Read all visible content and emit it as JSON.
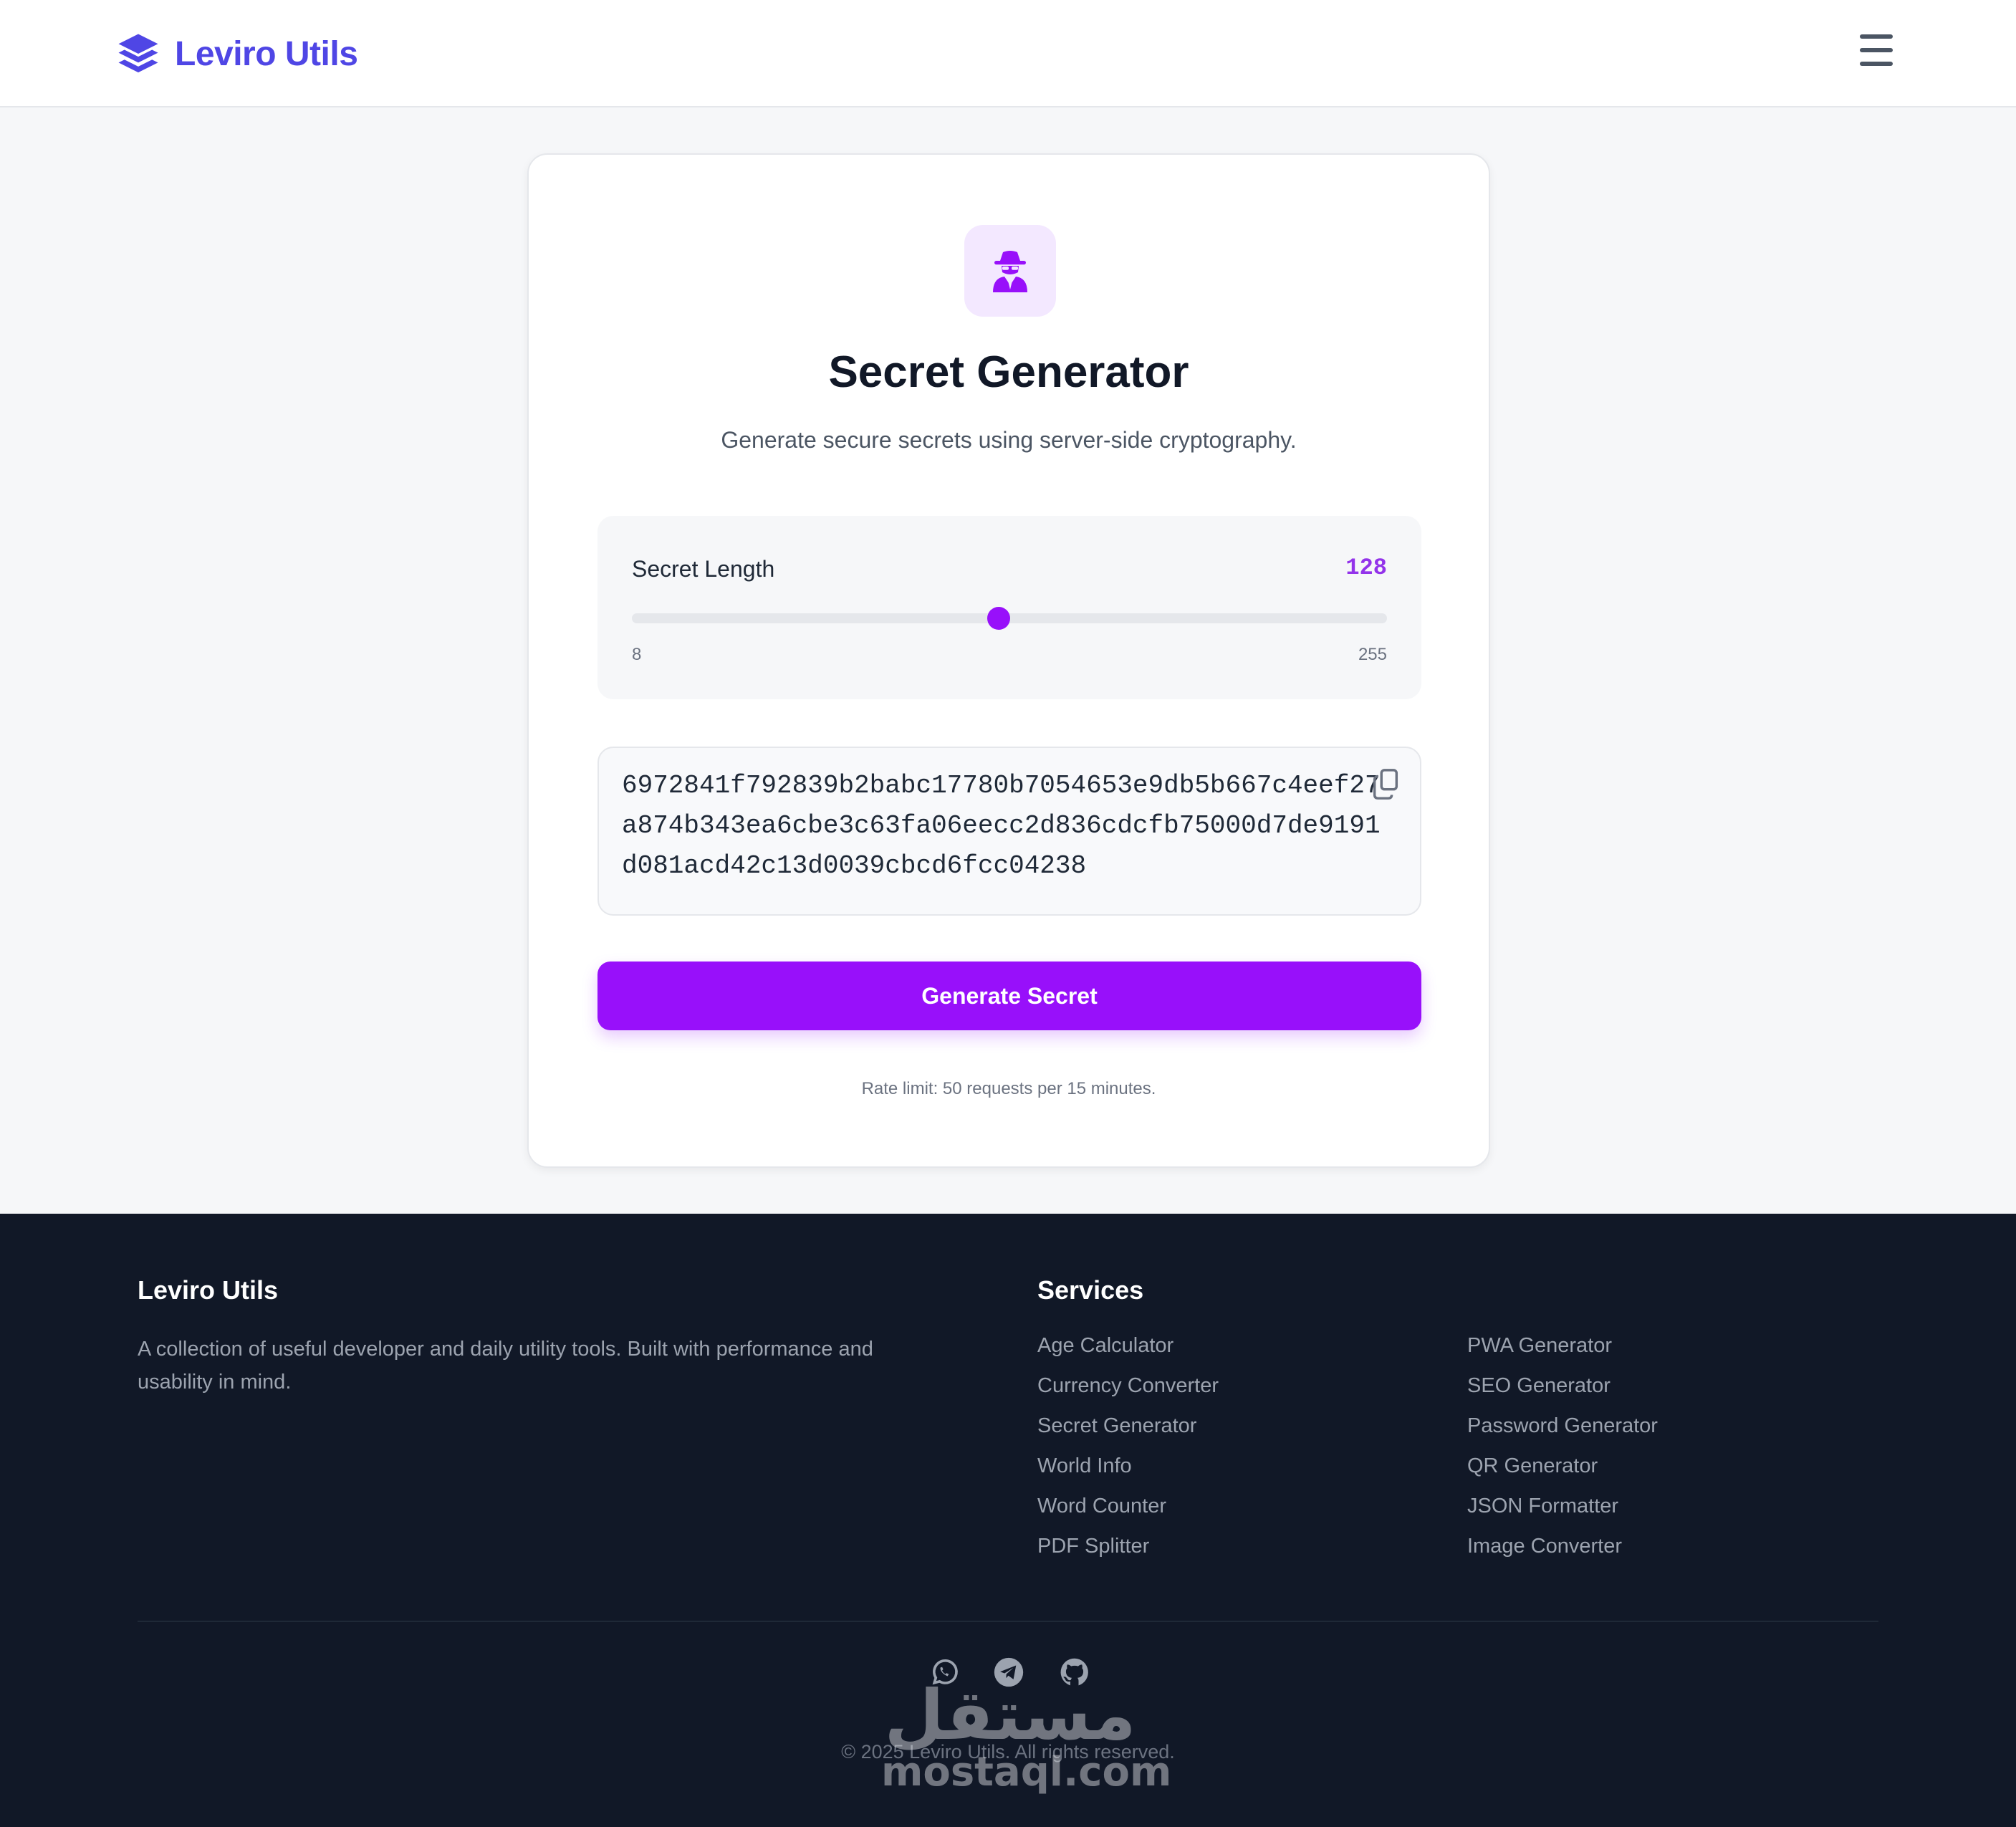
{
  "header": {
    "brand": "Leviro Utils",
    "brand_icon": "layers-icon",
    "menu_icon": "hamburger-menu-icon",
    "brand_color": "#4f46e5"
  },
  "tool": {
    "icon": "user-secret-icon",
    "title": "Secret Generator",
    "subtitle": "Generate secure secrets using server-side cryptography.",
    "length_label": "Secret Length",
    "length_value": "128",
    "length_min": "8",
    "length_max": "255",
    "slider_value": 128,
    "secret_lines": [
      "6972841f792839b2babc17780b7054653e9db5b667c4eef27",
      "a874b343ea6cbe3c63fa06eecc2d836cdcfb75000d7de9191",
      "d081acd42c13d0039cbcd6fcc04238"
    ],
    "copy_icon": "copy-icon",
    "generate_label": "Generate Secret",
    "rate_note": "Rate limit: 50 requests per 15 minutes.",
    "accent_color": "#9810fa"
  },
  "footer": {
    "brand": "Leviro Utils",
    "description": "A collection of useful developer and daily utility tools. Built with performance and usability in mind.",
    "services_heading": "Services",
    "services_col1": [
      "Age Calculator",
      "Currency Converter",
      "Secret Generator",
      "World Info",
      "Word Counter",
      "PDF Splitter"
    ],
    "services_col2": [
      "PWA Generator",
      "SEO Generator",
      "Password Generator",
      "QR Generator",
      "JSON Formatter",
      "Image Converter"
    ],
    "social_icons": [
      "whatsapp-icon",
      "telegram-icon",
      "github-icon"
    ],
    "copyright": "© 2025 Leviro Utils. All rights reserved.",
    "background": "#111827"
  },
  "watermark": {
    "arabic": "مستقل",
    "latin": "mostaql.com"
  }
}
